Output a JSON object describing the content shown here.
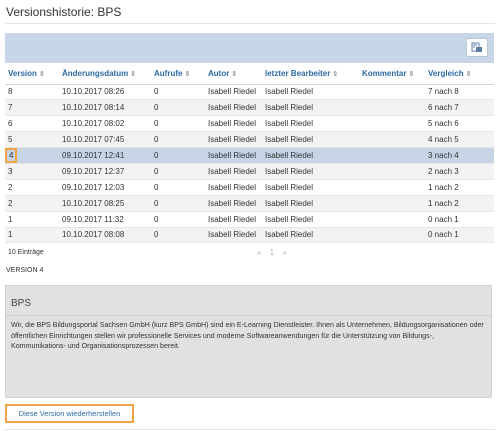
{
  "page": {
    "title": "Versionshistorie: BPS"
  },
  "table": {
    "columns": [
      "Version",
      "Änderungsdatum",
      "Aufrufe",
      "Autor",
      "letzter Bearbeiter",
      "Kommentar",
      "Vergleich"
    ],
    "rows": [
      {
        "version": "8",
        "date": "10.10.2017 08:26",
        "views": "0",
        "author": "Isabell Riedel",
        "editor": "Isabell Riedel",
        "comment": "",
        "compare": "7 nach 8"
      },
      {
        "version": "7",
        "date": "10.10.2017 08:14",
        "views": "0",
        "author": "Isabell Riedel",
        "editor": "Isabell Riedel",
        "comment": "",
        "compare": "6 nach 7"
      },
      {
        "version": "6",
        "date": "10.10.2017 08:02",
        "views": "0",
        "author": "Isabell Riedel",
        "editor": "Isabell Riedel",
        "comment": "",
        "compare": "5 nach 6"
      },
      {
        "version": "5",
        "date": "10.10.2017 07:45",
        "views": "0",
        "author": "Isabell Riedel",
        "editor": "Isabell Riedel",
        "comment": "",
        "compare": "4 nach 5"
      },
      {
        "version": "4",
        "date": "09.10.2017 12:41",
        "views": "0",
        "author": "Isabell Riedel",
        "editor": "Isabell Riedel",
        "comment": "",
        "compare": "3 nach 4"
      },
      {
        "version": "3",
        "date": "09.10.2017 12:37",
        "views": "0",
        "author": "Isabell Riedel",
        "editor": "Isabell Riedel",
        "comment": "",
        "compare": "2 nach 3"
      },
      {
        "version": "2",
        "date": "09.10.2017 12:03",
        "views": "0",
        "author": "Isabell Riedel",
        "editor": "Isabell Riedel",
        "comment": "",
        "compare": "1 nach 2"
      },
      {
        "version": "2",
        "date": "10.10.2017 08:25",
        "views": "0",
        "author": "Isabell Riedel",
        "editor": "Isabell Riedel",
        "comment": "",
        "compare": "1 nach 2"
      },
      {
        "version": "1",
        "date": "09.10.2017 11:32",
        "views": "0",
        "author": "Isabell Riedel",
        "editor": "Isabell Riedel",
        "comment": "",
        "compare": "0 nach 1"
      },
      {
        "version": "1",
        "date": "10.10.2017 08:08",
        "views": "0",
        "author": "Isabell Riedel",
        "editor": "Isabell Riedel",
        "comment": "",
        "compare": "0 nach 1"
      }
    ],
    "selected_row": 4
  },
  "footer": {
    "entries": "10 Einträge",
    "pager": "« 1 »"
  },
  "detail": {
    "label": "VERSION 4",
    "title": "BPS",
    "text": "Wir, die BPS Bildungsportal Sachsen GmbH (kurz BPS GmbH) sind ein E-Learning Dienstleister. Ihnen als Unternehmen, Bildungsorganisationen oder öffentlichen Einrichtungen stellen wir professionelle Services und moderne Softwareanwendungen für die Unterstützung von Bildungs-, Kommunikations- und Organisationsprozessen bereit."
  },
  "actions": {
    "restore_label": "Diese Version wiederherstellen"
  },
  "icons": {
    "export": "export-icon",
    "sort": "sort-icon"
  },
  "colors": {
    "accent": "#2a6aa5",
    "toolbar": "#c8d7e8",
    "selected": "#c6d4e6",
    "highlight": "#f0a347"
  }
}
